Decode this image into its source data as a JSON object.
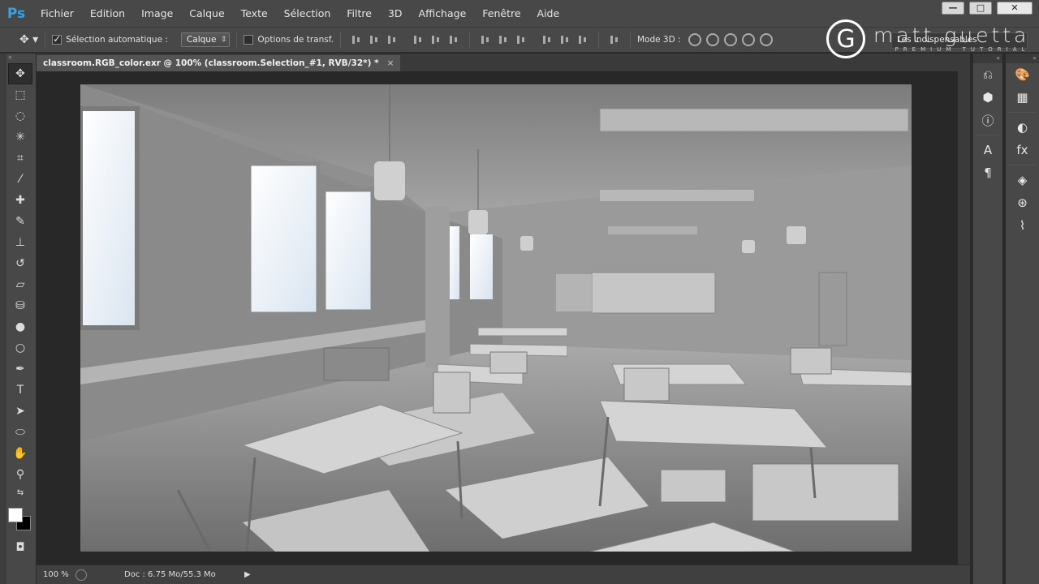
{
  "app": {
    "logo": "Ps"
  },
  "menu": [
    "Fichier",
    "Edition",
    "Image",
    "Calque",
    "Texte",
    "Sélection",
    "Filtre",
    "3D",
    "Affichage",
    "Fenêtre",
    "Aide"
  ],
  "window_controls": {
    "minimize": "—",
    "maximize": "□",
    "close": "✕"
  },
  "options": {
    "auto_select_label": "Sélection automatique :",
    "auto_select_value": "Calque",
    "transform_label": "Options de transf.",
    "mode3d_label": "Mode 3D :"
  },
  "workspace": "Les indispensables",
  "brand": {
    "letter": "G",
    "name": "matt guetta",
    "subtitle": "PREMIUM TUTORIAL"
  },
  "document": {
    "tab_title": "classroom.RGB_color.exr @ 100% (classroom.Selection_#1, RVB/32*) *",
    "tab_close": "×"
  },
  "status": {
    "zoom": "100 %",
    "doc_info": "Doc : 6.75 Mo/55.3 Mo",
    "arrow": "▶"
  },
  "tools": [
    {
      "name": "move-tool-icon",
      "glyph": "✥"
    },
    {
      "name": "marquee-tool-icon",
      "glyph": "⬚"
    },
    {
      "name": "lasso-tool-icon",
      "glyph": "◌"
    },
    {
      "name": "magic-wand-tool-icon",
      "glyph": "✳"
    },
    {
      "name": "crop-tool-icon",
      "glyph": "⌗"
    },
    {
      "name": "eyedropper-tool-icon",
      "glyph": "⁄"
    },
    {
      "name": "healing-brush-tool-icon",
      "glyph": "✚"
    },
    {
      "name": "brush-tool-icon",
      "glyph": "✎"
    },
    {
      "name": "stamp-tool-icon",
      "glyph": "⊥"
    },
    {
      "name": "history-brush-tool-icon",
      "glyph": "↺"
    },
    {
      "name": "eraser-tool-icon",
      "glyph": "▱"
    },
    {
      "name": "bucket-tool-icon",
      "glyph": "⛁"
    },
    {
      "name": "blur-tool-icon",
      "glyph": "●"
    },
    {
      "name": "dodge-tool-icon",
      "glyph": "○"
    },
    {
      "name": "pen-tool-icon",
      "glyph": "✒"
    },
    {
      "name": "type-tool-icon",
      "glyph": "T"
    },
    {
      "name": "path-selection-tool-icon",
      "glyph": "➤"
    },
    {
      "name": "ellipse-tool-icon",
      "glyph": "⬭"
    },
    {
      "name": "hand-tool-icon",
      "glyph": "✋"
    },
    {
      "name": "zoom-tool-icon",
      "glyph": "⚲"
    }
  ],
  "colors": {
    "foreground": "#ffffff",
    "background": "#000000"
  },
  "panel_a_icons": [
    {
      "name": "history-panel-icon",
      "glyph": "⎌"
    },
    {
      "name": "properties-3d-panel-icon",
      "glyph": "⬢"
    },
    {
      "name": "info-panel-icon",
      "glyph": "ⓘ"
    },
    {
      "name": "character-panel-icon",
      "glyph": "A"
    },
    {
      "name": "paragraph-panel-icon",
      "glyph": "¶"
    }
  ],
  "panel_b_icons": [
    {
      "name": "color-panel-icon",
      "glyph": "🎨"
    },
    {
      "name": "swatches-panel-icon",
      "glyph": "▦"
    },
    {
      "name": "adjustments-panel-icon",
      "glyph": "◐"
    },
    {
      "name": "styles-panel-icon",
      "glyph": "fx"
    },
    {
      "name": "layers-panel-icon",
      "glyph": "◈"
    },
    {
      "name": "channels-panel-icon",
      "glyph": "⊛"
    },
    {
      "name": "paths-panel-icon",
      "glyph": "⌇"
    }
  ]
}
